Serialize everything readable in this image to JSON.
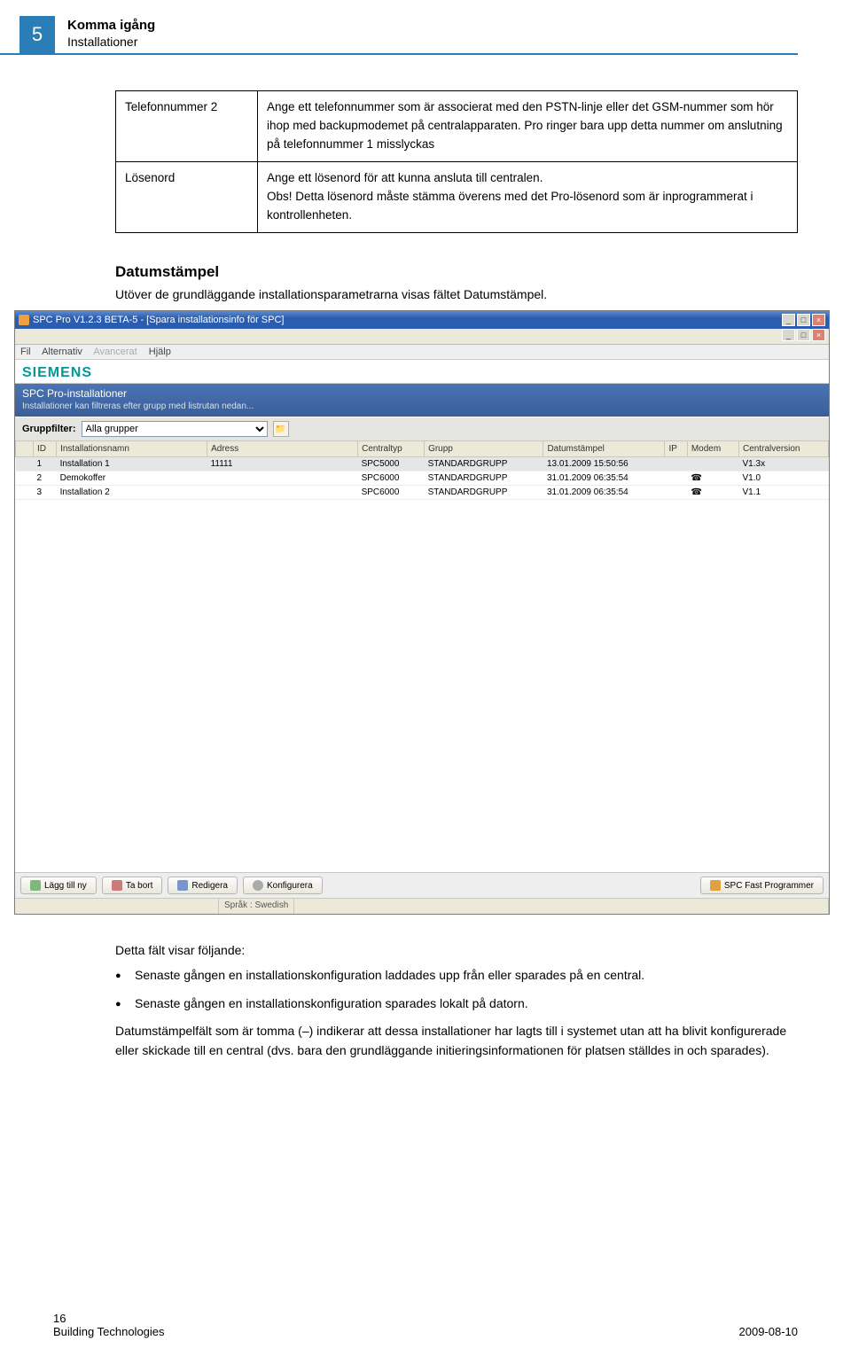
{
  "chapter": {
    "num": "5",
    "title": "Komma igång",
    "subtitle": "Installationer"
  },
  "defs": {
    "r1_label": "Telefonnummer 2",
    "r1_text": "Ange ett telefonnummer som är associerat med den PSTN-linje eller det GSM-nummer som hör ihop med backupmodemet på centralapparaten. Pro ringer bara upp detta nummer om anslutning på telefonnummer 1 misslyckas",
    "r2_label": "Lösenord",
    "r2_text": "Ange ett lösenord för att kunna ansluta till centralen.\nObs! Detta lösenord måste stämma överens med det Pro-lösenord som är inprogrammerat i kontrollenheten."
  },
  "section": {
    "heading": "Datumstämpel",
    "intro": "Utöver de grundläggande installationsparametrarna visas fältet Datumstämpel."
  },
  "app": {
    "title": "SPC Pro V1.2.3 BETA-5 - [Spara installationsinfo för SPC]",
    "menu": {
      "fil": "Fil",
      "alt": "Alternativ",
      "av": "Avancerat",
      "hj": "Hjälp"
    },
    "brand": "SIEMENS",
    "bluehdr_t1": "SPC Pro-installationer",
    "bluehdr_t2": "Installationer kan filtreras efter grupp med listrutan nedan...",
    "filter_label": "Gruppfilter:",
    "filter_value": "Alla grupper",
    "cols": {
      "sort": "",
      "id": "ID",
      "inst": "Installationsnamn",
      "addr": "Adress",
      "ctype": "Centraltyp",
      "grp": "Grupp",
      "date": "Datumstämpel",
      "ip": "IP",
      "modem": "Modem",
      "ver": "Centralversion"
    },
    "rows": [
      {
        "id": "1",
        "inst": "Installation 1",
        "addr": "11111",
        "ctype": "SPC5000",
        "grp": "STANDARDGRUPP",
        "date": "13.01.2009 15:50:56",
        "ip": "",
        "modem": "",
        "ver": "V1.3x"
      },
      {
        "id": "2",
        "inst": "Demokoffer",
        "addr": "",
        "ctype": "SPC6000",
        "grp": "STANDARDGRUPP",
        "date": "31.01.2009 06:35:54",
        "ip": "",
        "modem": "☎",
        "ver": "V1.0"
      },
      {
        "id": "3",
        "inst": "Installation 2",
        "addr": "",
        "ctype": "SPC6000",
        "grp": "STANDARDGRUPP",
        "date": "31.01.2009 06:35:54",
        "ip": "",
        "modem": "☎",
        "ver": "V1.1"
      }
    ],
    "btns": {
      "add": "Lägg till ny",
      "del": "Ta bort",
      "edit": "Redigera",
      "conf": "Konfigurera",
      "fast": "SPC Fast Programmer"
    },
    "status": {
      "lang": "Språk : Swedish"
    }
  },
  "post": {
    "lead": "Detta fält visar följande:",
    "li1": "Senaste gången en installationskonfiguration laddades upp från eller sparades på en central.",
    "li2": "Senaste gången en installationskonfiguration sparades lokalt på datorn.",
    "para": "Datumstämpelfält som är tomma (–) indikerar att dessa installationer har lagts till i systemet utan att ha blivit konfigurerade eller skickade till en central (dvs. bara den grundläggande initieringsinformationen för platsen ställdes in och sparades)."
  },
  "footer": {
    "page": "16",
    "org": "Building Technologies",
    "date": "2009-08-10"
  }
}
